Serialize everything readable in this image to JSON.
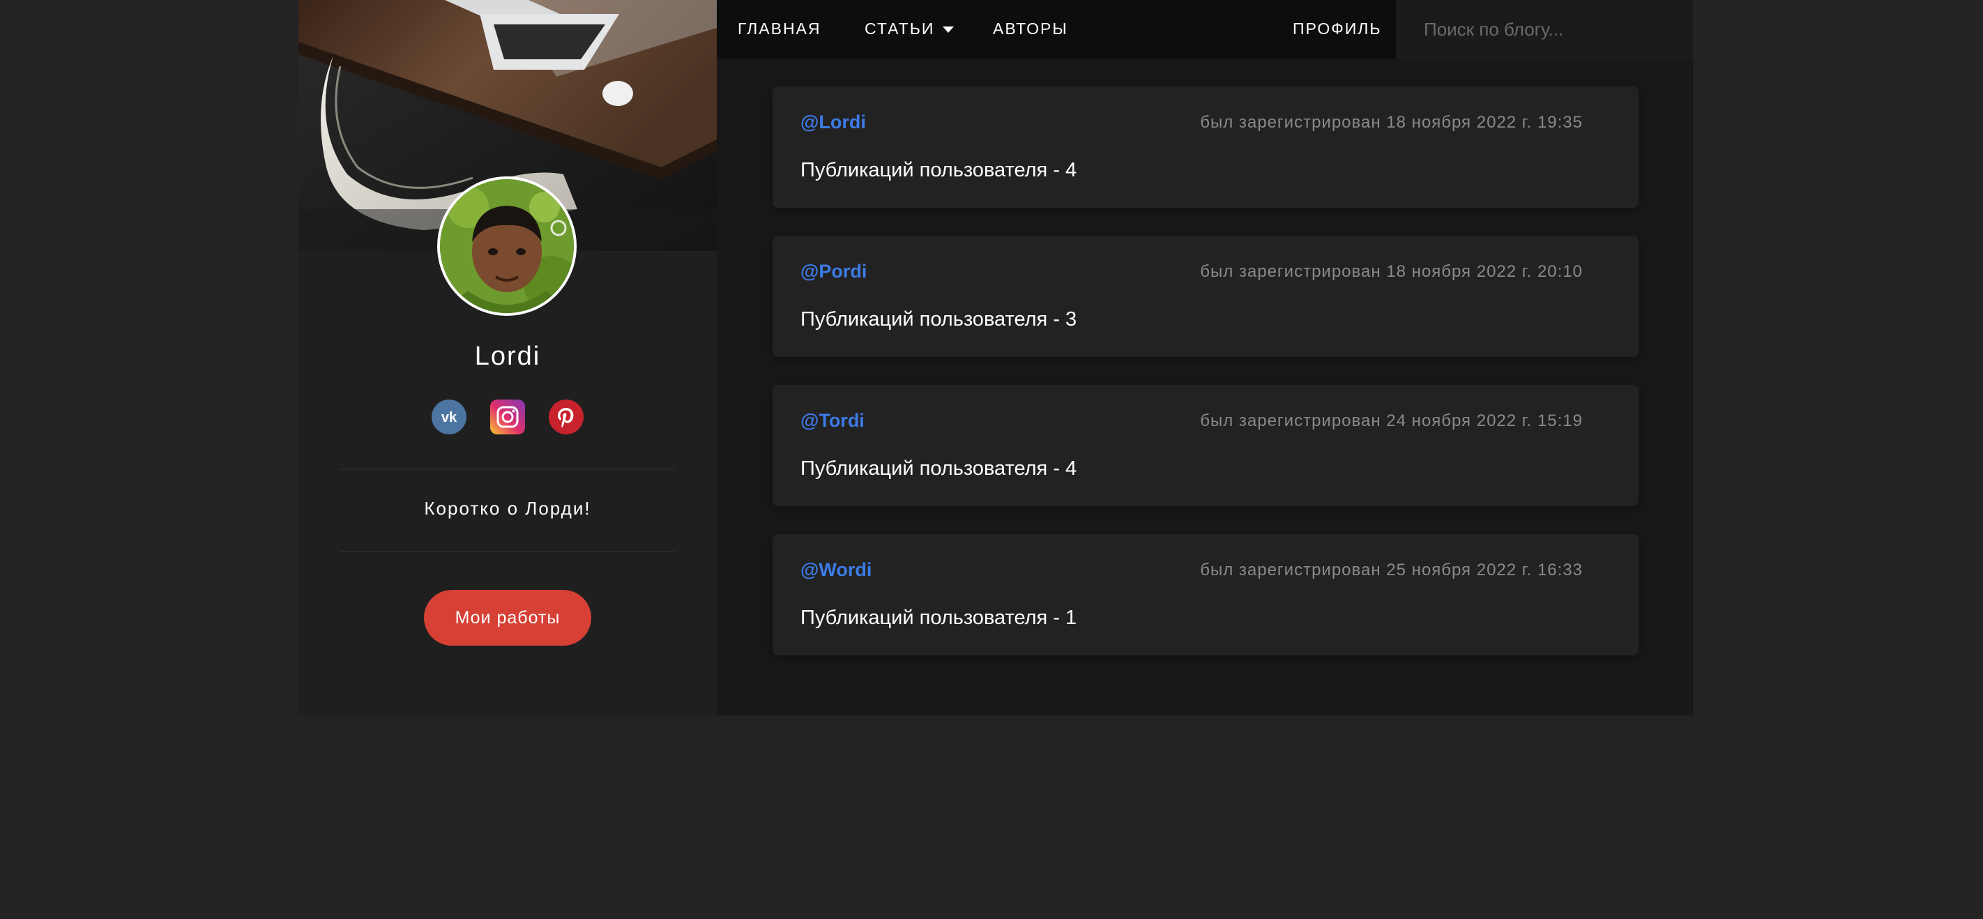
{
  "colors": {
    "background": "#232323",
    "sidebar": "#1f1f1f",
    "main": "#181818",
    "nav": "#0d0d0d",
    "card": "#222222",
    "link_blue": "#3d7be8",
    "button_red": "#d64035",
    "muted": "#8a8a8a"
  },
  "nav": {
    "home": "ГЛАВНАЯ",
    "articles": "СТАТЬИ",
    "authors": "АВТОРЫ",
    "profile": "ПРОФИЛЬ",
    "search_placeholder": "Поиск по блогу..."
  },
  "sidebar": {
    "name": "Lordi",
    "socials": [
      {
        "icon": "vk-icon",
        "color": "#4c75a3"
      },
      {
        "icon": "instagram-icon",
        "color": "#d6249f"
      },
      {
        "icon": "pinterest-icon",
        "color": "#c8232c"
      }
    ],
    "about": "Коротко о Лорди!",
    "works_button": "Мои работы"
  },
  "authors": [
    {
      "handle": "@Lordi",
      "registered": "был зарегистрирован 18 ноября 2022 г. 19:35",
      "posts": "Публикаций пользователя - 4"
    },
    {
      "handle": "@Pordi",
      "registered": "был зарегистрирован 18 ноября 2022 г. 20:10",
      "posts": "Публикаций пользователя - 3"
    },
    {
      "handle": "@Tordi",
      "registered": "был зарегистрирован 24 ноября 2022 г. 15:19",
      "posts": "Публикаций пользователя - 4"
    },
    {
      "handle": "@Wordi",
      "registered": "был зарегистрирован 25 ноября 2022 г. 16:33",
      "posts": "Публикаций пользователя - 1"
    }
  ]
}
